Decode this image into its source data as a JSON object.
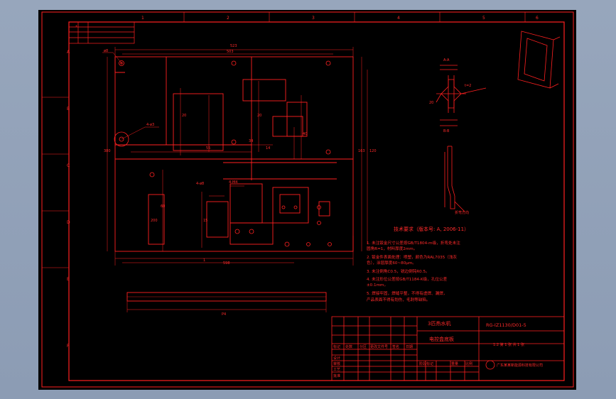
{
  "border": {
    "col_markers": [
      "1",
      "2",
      "3",
      "4",
      "5",
      "6"
    ],
    "row_markers": [
      "A",
      "B",
      "C",
      "D",
      "E",
      "F"
    ]
  },
  "main_view": {
    "top_dims": [
      "ø8",
      "523",
      "503"
    ],
    "side_dims": [
      "380",
      "163",
      "120",
      "34",
      "14"
    ],
    "bottom_dims": [
      "598",
      "1"
    ],
    "inner_dims": [
      "20",
      "20",
      "55",
      "200",
      "15",
      "40",
      "60"
    ],
    "tags": [
      "4-ø3",
      "4-ø8",
      "4-M4"
    ]
  },
  "bottom_view": {
    "dim": "P4"
  },
  "section_view": {
    "label_top": "A-A",
    "label_bottom": "B-B",
    "dims": [
      "t=2",
      "20"
    ]
  },
  "side_view": {
    "callout": "折弯方向"
  },
  "tech_requirements": {
    "title": "技术要求（版本号: A, 2006-11）",
    "items": [
      "1. 未注钣金尺寸公差按GB/T1804-m级，折弯处未注",
      "   圆角R=1，材料厚度2mm。",
      "2. 钣金件表面处理：喷塑，颜色为RAL7035（浅灰",
      "   色），涂层厚度60~80μm。",
      "3. 未注倒角C0.5，锐边倒钝R0.5。",
      "4. 未注形位公差按GB/T1184-K级，孔位公差",
      "   ±0.1mm。",
      "5. 焊接牢固，焊缝平整，不得有虚焊、漏焊，",
      "   产品表面不得有划伤，毛刺等缺陷。"
    ]
  },
  "title_block": {
    "product_name": "3匹热水机",
    "part_name": "电控盒底板",
    "drawing_no": "RG-IZ1130/D01-5",
    "scale_text": "1:2  第 1 张  共 1 张",
    "company": "广东某某新能源科技有限公司",
    "header_cells": [
      "标记",
      "处数",
      "分区",
      "更改文件号",
      "签名",
      "日期"
    ],
    "row_labels": [
      "设计",
      "审核",
      "工艺",
      "批准"
    ],
    "mass_label": "阶段标记",
    "weight_label": "重量",
    "ratio_label": "比例"
  }
}
